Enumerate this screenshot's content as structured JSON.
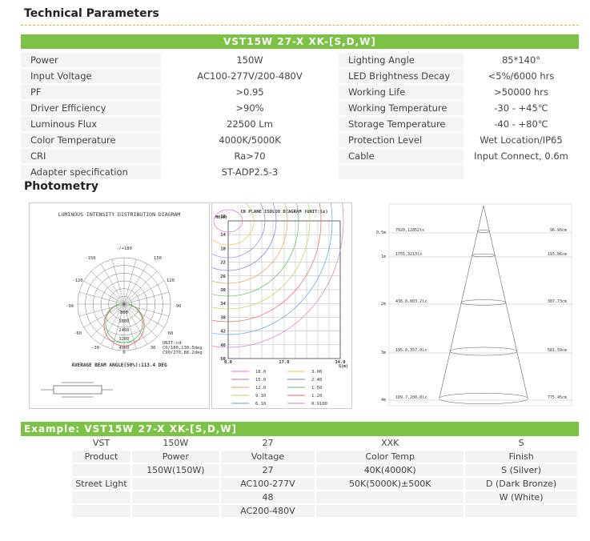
{
  "sections": {
    "technical_title": "Technical Parameters",
    "photometry_title": "Photometry"
  },
  "spec": {
    "model_bar": "VST15W 27-X XK-[S,D,W]",
    "rows": [
      {
        "l1": "Power",
        "v1": "150W",
        "l2": "Lighting Angle",
        "v2": "85*140°"
      },
      {
        "l1": "Input Voltage",
        "v1": "AC100-277V/200-480V",
        "l2": "LED Brightness Decay",
        "v2": "<5%/6000 hrs"
      },
      {
        "l1": "PF",
        "v1": ">0.95",
        "l2": "Working Life",
        "v2": ">50000 hrs"
      },
      {
        "l1": "Driver Efficiency",
        "v1": ">90%",
        "l2": "Working Temperature",
        "v2": "-30 - +45℃"
      },
      {
        "l1": "Luminous Flux",
        "v1": "22500 Lm",
        "l2": "Storage Temperature",
        "v2": "-40 - +80℃"
      },
      {
        "l1": "Color Temperature",
        "v1": "4000K/5000K",
        "l2": "Protection Level",
        "v2": "Wet Location/IP65"
      },
      {
        "l1": "CRI",
        "v1": "Ra>70",
        "l2": "Cable",
        "v2": "Input Connect, 0.6m"
      },
      {
        "l1": "Adapter specification",
        "v1": "ST-ADP2.5-3",
        "l2": "",
        "v2": ""
      }
    ]
  },
  "polar": {
    "title": "LUMINOUS INTENSITY DISTRIBUTION DIAGRAM",
    "angles": [
      "-/+180",
      "-150",
      "150",
      "-120",
      "120",
      "-90",
      "90",
      "-60",
      "60",
      "-30",
      "0",
      "30"
    ],
    "rings": [
      "800",
      "1600",
      "2400",
      "3200",
      "4000"
    ],
    "unit": "UNIT:cd",
    "c0": "C0/180,130.5deg",
    "c90": "C90/270,88.2deg",
    "beam": "AVERAGE BEAM ANGLE(50%):113.4 DEG"
  },
  "isolux": {
    "title": "C0 PLANE ISOLUX DIAGRAM (UNIT:lx)",
    "mh": "MH(m)",
    "yticks": [
      "10",
      "14",
      "18",
      "22",
      "26",
      "30",
      "34",
      "38",
      "42",
      "46",
      "50"
    ],
    "xticks": [
      "0.0",
      "17.0",
      "34.0"
    ],
    "xunit": "S(m)",
    "legend": [
      {
        "v": "18.0",
        "c": "#e96fd6"
      },
      {
        "v": "3.00",
        "c": "#e8c24a"
      },
      {
        "v": "15.0",
        "c": "#a678e0"
      },
      {
        "v": "2.40",
        "c": "#7b7be6"
      },
      {
        "v": "12.0",
        "c": "#f29b56"
      },
      {
        "v": "1.50",
        "c": "#5bbf5b"
      },
      {
        "v": "9.10",
        "c": "#b4d94f"
      },
      {
        "v": "1.20",
        "c": "#e5646e"
      },
      {
        "v": "6.10",
        "c": "#5aa2e6"
      },
      {
        "v": "0.9100",
        "c": "#d77ac9"
      }
    ]
  },
  "cone": {
    "rows": [
      {
        "h": "0.5m",
        "lux": "7020,12852lx",
        "d": "96.93cm"
      },
      {
        "h": "1m",
        "lux": "1755,3213lx",
        "d": "193.86cm"
      },
      {
        "h": "2m",
        "lux": "438.8,803.2lx",
        "d": "387.73cm"
      },
      {
        "h": "3m",
        "lux": "195.0,357.0lx",
        "d": "581.59cm"
      },
      {
        "h": "4m",
        "lux": "109.7,200.8lx",
        "d": "775.45cm"
      }
    ]
  },
  "example": {
    "bar": "Example: VST15W 27-X XK-[S,D,W]",
    "code_row": [
      "VST",
      "150W",
      "27",
      "XXK",
      "S"
    ],
    "rows": [
      [
        "Product",
        "Power",
        "Voltage",
        "Color Temp",
        "Finish"
      ],
      [
        "",
        "150W(150W)",
        "27",
        "40K(4000K)",
        "S (Silver)"
      ],
      [
        "Street Light",
        "",
        "AC100-277V",
        "50K(5000K)±500K",
        "D (Dark Bronze)"
      ],
      [
        "",
        "",
        "48",
        "",
        "W (White)"
      ],
      [
        "",
        "",
        "AC200-480V",
        "",
        ""
      ]
    ]
  }
}
